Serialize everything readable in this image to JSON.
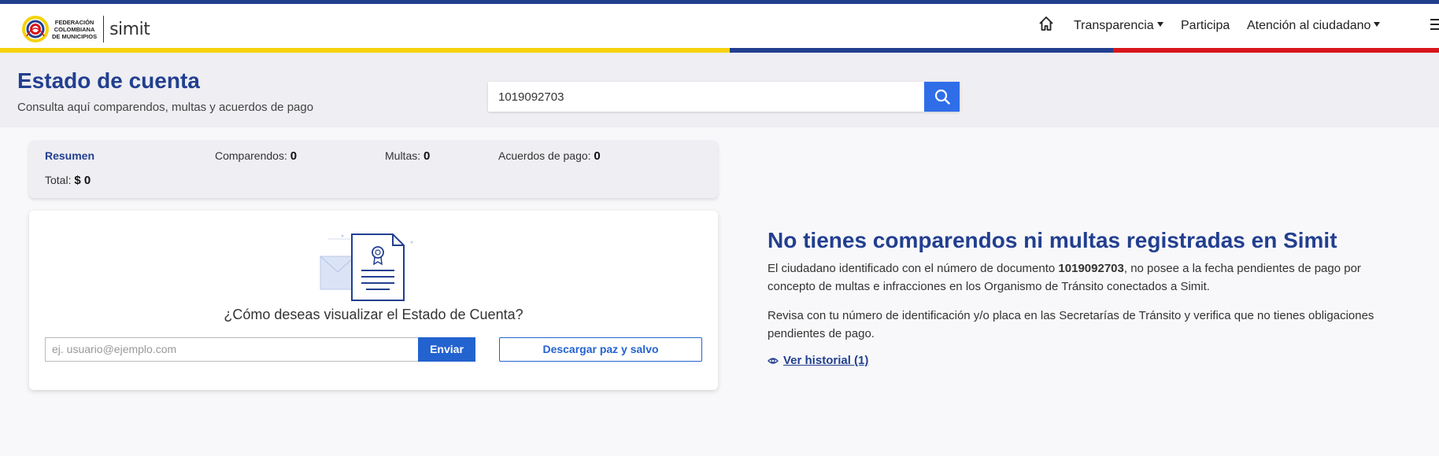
{
  "header": {
    "logo_fed_line1": "FEDERACIÓN",
    "logo_fed_line2": "COLOMBIANA",
    "logo_fed_line3": "DE MUNICIPIOS",
    "logo_simit": "simit",
    "nav": {
      "transparencia": "Transparencia",
      "participa": "Participa",
      "atencion": "Atención al ciudadano"
    }
  },
  "hero": {
    "title": "Estado de cuenta",
    "subtitle": "Consulta aquí comparendos, multas y acuerdos de pago",
    "search_value": "1019092703"
  },
  "summary": {
    "resumen": "Resumen",
    "comparendos_label": "Comparendos:",
    "comparendos_value": "0",
    "multas_label": "Multas:",
    "multas_value": "0",
    "acuerdos_label": "Acuerdos de pago:",
    "acuerdos_value": "0",
    "total_label": "Total:",
    "total_value": "$ 0"
  },
  "card": {
    "question": "¿Cómo deseas visualizar el Estado de Cuenta?",
    "email_placeholder": "ej. usuario@ejemplo.com",
    "enviar": "Enviar",
    "paz_y_salvo": "Descargar paz y salvo"
  },
  "info": {
    "title": "No tienes comparendos ni multas registradas en Simit",
    "p1_before": "El ciudadano identificado con el número de documento ",
    "p1_doc": "1019092703",
    "p1_after": ", no posee a la fecha pendientes de pago por concepto de multas e infracciones en los Organismo de Tránsito conectados a Simit.",
    "p2": "Revisa con tu número de identificación y/o placa en las Secretarías de Tránsito y verifica que no tienes obligaciones pendientes de pago.",
    "historial": "Ver historial (1)"
  },
  "colors": {
    "brand_blue": "#223f8f",
    "button_blue": "#2f6ee8",
    "flag_yellow": "#f6d20c",
    "flag_red": "#d8151b"
  }
}
